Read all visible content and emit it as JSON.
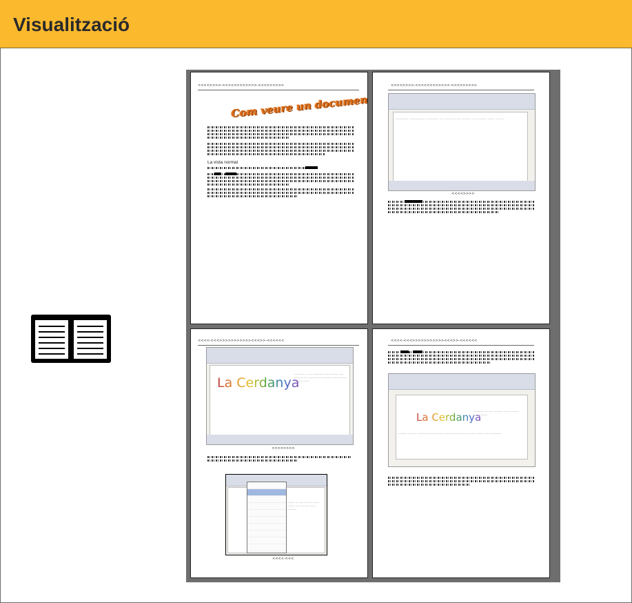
{
  "header": {
    "title": "Visualització"
  },
  "icon": {
    "name": "open-book"
  },
  "pages": [
    {
      "running_head": "<<<<>>>>-<<<<<<<<>>>>-<<<>>>>>>",
      "wordart": "Com veure un document",
      "subheading": "La vista normal"
    },
    {
      "running_head": "<<<<>>>>-<<<<<<<<>>>>-<<<>>>>>>",
      "caption": "<<<<>>>>"
    },
    {
      "running_head": "<<<<-<<<>>>>>>>>>>><<<>>-<<<<<<",
      "logo_text": "La Cerdanya",
      "caption1": "<<<<>>>>",
      "caption2": "<<<<-<<<"
    },
    {
      "running_head": "<<<<-<<<>>>>>>>>>>><<<>>-<<<<<<",
      "logo_text": "La Cerdanya"
    }
  ]
}
